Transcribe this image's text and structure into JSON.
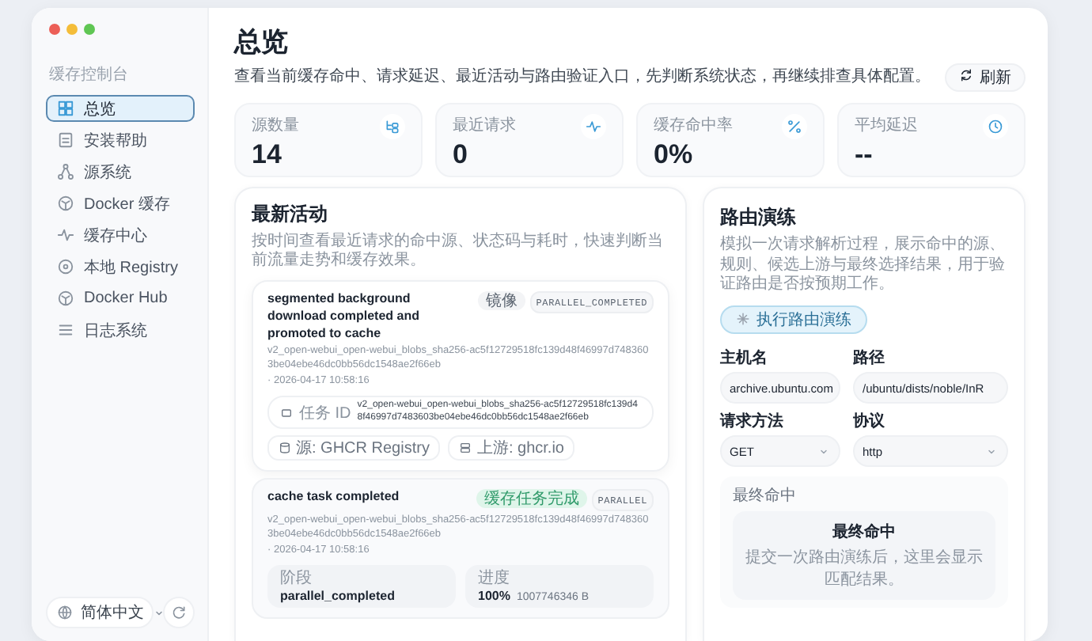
{
  "sidebar": {
    "section_label": "缓存控制台",
    "items": [
      {
        "label": "总览",
        "selected": true
      },
      {
        "label": "安装帮助",
        "selected": false
      },
      {
        "label": "源系统",
        "selected": false
      },
      {
        "label": "Docker 缓存",
        "selected": false
      },
      {
        "label": "缓存中心",
        "selected": false
      },
      {
        "label": "本地 Registry",
        "selected": false
      },
      {
        "label": "Docker Hub",
        "selected": false
      },
      {
        "label": "日志系统",
        "selected": false
      }
    ],
    "language": "简体中文"
  },
  "header": {
    "title": "总览",
    "subtitle": "查看当前缓存命中、请求延迟、最近活动与路由验证入口，先判断系统状态，再继续排查具体配置。",
    "refresh_button": "刷新"
  },
  "stats": [
    {
      "label": "源数量",
      "value": "14"
    },
    {
      "label": "最近请求",
      "value": "0"
    },
    {
      "label": "缓存命中率",
      "value": "0%"
    },
    {
      "label": "平均延迟",
      "value": "--"
    }
  ],
  "activity": {
    "title": "最新活动",
    "description": "按时间查看最近请求的命中源、状态码与耗时，快速判断当前流量走势和缓存效果。",
    "entries": [
      {
        "title": "segmented background download completed and promoted to cache",
        "badges": [
          {
            "label": "镜像",
            "kind": "plain"
          },
          {
            "label": "PARALLEL_COMPLETED",
            "kind": "code"
          }
        ],
        "hash": "v2_open-webui_open-webui_blobs_sha256-ac5f12729518fc139d48f46997d7483603be04ebe46dc0bb56dc1548ae2f66eb",
        "time": "· 2026-04-17 10:58:16",
        "task_label": "任务 ID",
        "task_id": "v2_open-webui_open-webui_blobs_sha256-ac5f12729518fc139d48f46997d7483603be04ebe46dc0bb56dc1548ae2f66eb",
        "chips": [
          "源: GHCR Registry",
          "上游: ghcr.io"
        ]
      },
      {
        "title": "cache task completed",
        "badges": [
          {
            "label": "缓存任务完成",
            "kind": "success"
          },
          {
            "label": "PARALLEL",
            "kind": "code"
          }
        ],
        "hash": "v2_open-webui_open-webui_blobs_sha256-ac5f12729518fc139d48f46997d7483603be04ebe46dc0bb56dc1548ae2f66eb",
        "time": "· 2026-04-17 10:58:16",
        "details": [
          {
            "label": "阶段",
            "value": "parallel_completed"
          },
          {
            "label": "进度",
            "value": "100%",
            "extra": "1007746346 B"
          }
        ]
      }
    ]
  },
  "route": {
    "title": "路由演练",
    "description": "模拟一次请求解析过程，展示命中的源、规则、候选上游与最终选择结果，用于验证路由是否按预期工作。",
    "run_button": "执行路由演练",
    "fields": [
      {
        "label": "主机名",
        "value": "archive.ubuntu.com",
        "kind": "text"
      },
      {
        "label": "路径",
        "value": "/ubuntu/dists/noble/InR",
        "kind": "text"
      },
      {
        "label": "请求方法",
        "value": "GET",
        "kind": "select"
      },
      {
        "label": "协议",
        "value": "http",
        "kind": "select"
      }
    ],
    "result_label": "最终命中",
    "result_title": "最终命中",
    "result_hint": "提交一次路由演练后，这里会显示匹配结果。"
  }
}
